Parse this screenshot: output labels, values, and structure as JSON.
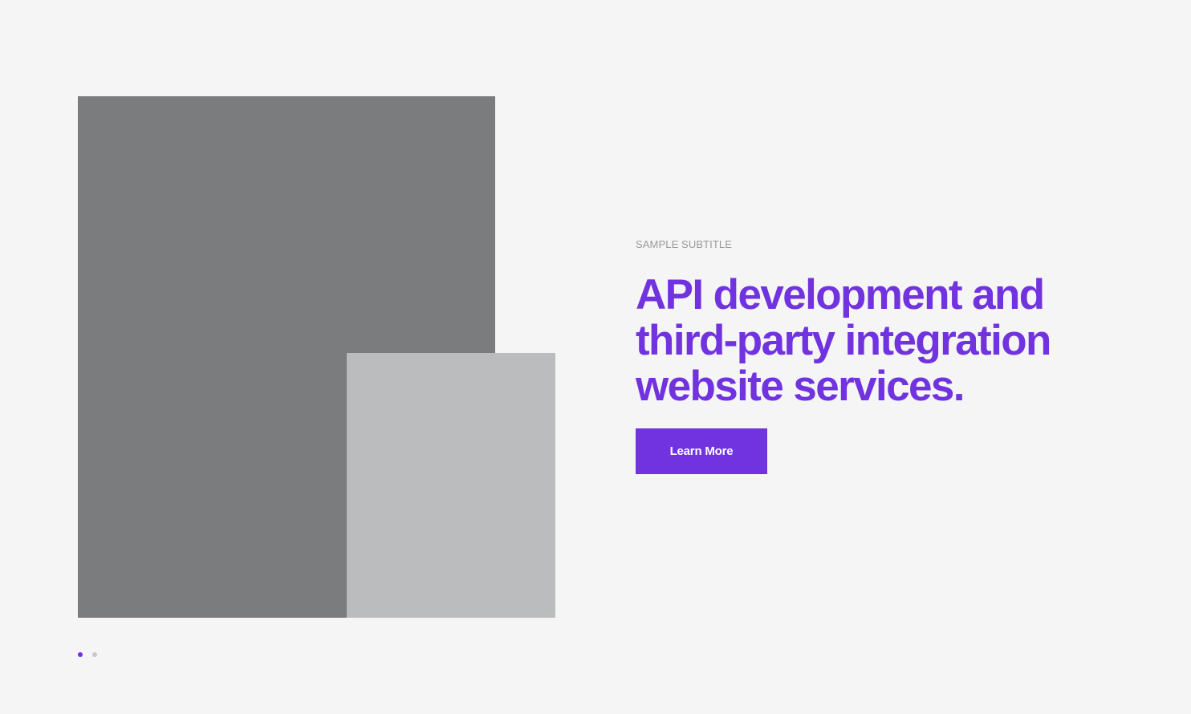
{
  "hero": {
    "subtitle": "SAMPLE SUBTITLE",
    "headline_lines": [
      "API development and",
      "third-party integration",
      "website services."
    ],
    "cta_label": "Learn More"
  },
  "slider": {
    "slide_count": 2,
    "active_index": 0
  },
  "colors": {
    "accent": "#7132e0",
    "background": "#f5f5f5",
    "image_primary": "#7b7c7e",
    "image_secondary": "#bbbcbe",
    "subtitle": "#9a9a9a",
    "dot_inactive": "#c8c8c8"
  }
}
